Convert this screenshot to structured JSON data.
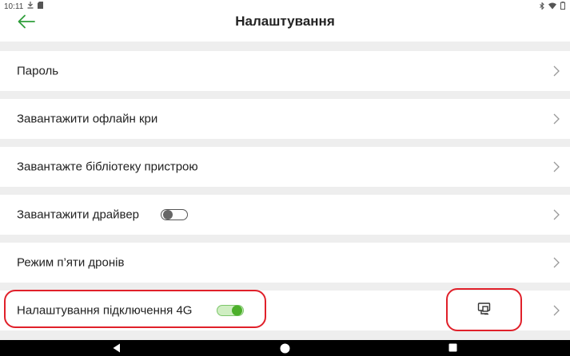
{
  "status_bar": {
    "time": "10:11",
    "left_icons": [
      "download-icon",
      "sd-card-icon"
    ],
    "right_icons": [
      "bluetooth-icon",
      "wifi-icon",
      "battery-icon"
    ]
  },
  "header": {
    "title": "Налаштування",
    "back_icon": "arrow-left-icon",
    "accent_color": "#2e9e3a"
  },
  "settings": {
    "items": [
      {
        "label": "Пароль"
      },
      {
        "label": "Завантажити офлайн кри"
      },
      {
        "label": "Завантажте бібліотеку пристрою"
      },
      {
        "label": "Завантажити драйвер",
        "toggle": "off"
      },
      {
        "label": "Режим п’яти дронів"
      },
      {
        "label": "Налаштування підключення 4G",
        "toggle": "on",
        "icon": "device-settings-icon"
      }
    ]
  },
  "colors": {
    "toggle_on": "#4caf2a",
    "highlight": "#e0202a"
  },
  "nav_bar": {
    "buttons": [
      "back-triangle-icon",
      "home-circle-icon",
      "recents-square-icon"
    ]
  }
}
